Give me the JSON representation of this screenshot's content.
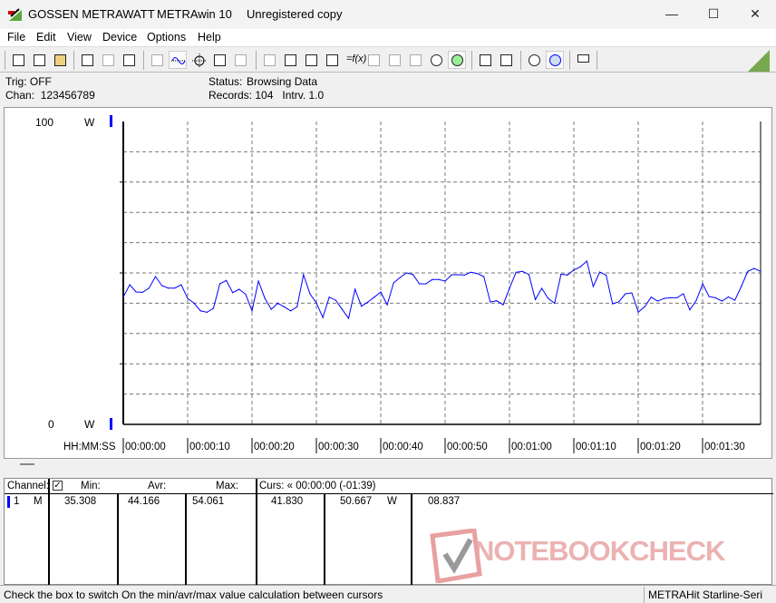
{
  "window": {
    "brand": "GOSSEN METRAWATT",
    "app": "METRAwin 10",
    "license": "Unregistered copy",
    "minimize": "—",
    "maximize": "☐",
    "close": "✕"
  },
  "menu": [
    "File",
    "Edit",
    "View",
    "Device",
    "Options",
    "Help"
  ],
  "toolbar": {
    "icons": [
      "save-icon",
      "save-as-icon",
      "open-icon",
      "read-memory-icon",
      "read-memory-disabled-icon",
      "device-memory-icon",
      "display-values-icon",
      "yt-chart-icon",
      "xy-chart-icon",
      "table-icon",
      "histogram-icon",
      "transfer-icon",
      "import-icon",
      "logic-icon",
      "monitor-icon",
      "function-icon",
      "device-icon",
      "trigger-icon",
      "trigger-wave-icon",
      "clock-icon",
      "stopwatch-icon",
      "print-icon",
      "print-setup-icon",
      "zoom-wave-icon",
      "zoom-icon",
      "comment-icon"
    ],
    "brand_color": "#76a94e"
  },
  "info": {
    "trig": "Trig: OFF",
    "chan": "Chan:  123456789",
    "status_label": "Status:",
    "status_value": "Browsing Data",
    "records": "Records: 104   Intrv. 1.0"
  },
  "chart_data": {
    "type": "line",
    "ylim": [
      0,
      100
    ],
    "y_top_label": "100",
    "y_bottom_label": "0",
    "y_unit": "W",
    "xlabel": "HH:MM:SS",
    "x_ticks": [
      "00:00:00",
      "00:00:10",
      "00:00:20",
      "00:00:30",
      "00:00:40",
      "00:00:50",
      "00:01:00",
      "00:01:10",
      "00:01:20",
      "00:01:30"
    ],
    "interval_s": 1,
    "grid": true,
    "line_color": "#0000ff",
    "values": [
      42.0,
      46.1,
      43.7,
      43.6,
      45.0,
      48.8,
      45.8,
      45.0,
      45.0,
      46.1,
      41.6,
      40.0,
      37.5,
      37.0,
      38.3,
      46.4,
      47.5,
      43.5,
      44.6,
      43.0,
      37.5,
      47.3,
      41.6,
      38.0,
      40.0,
      38.8,
      37.5,
      38.8,
      49.4,
      43.1,
      40.1,
      35.3,
      42.0,
      41.0,
      38.0,
      35.0,
      44.6,
      39.0,
      40.4,
      42.0,
      43.7,
      39.5,
      46.7,
      48.5,
      50.0,
      49.5,
      46.4,
      46.4,
      47.8,
      47.8,
      47.3,
      49.4,
      49.4,
      49.3,
      50.2,
      49.8,
      48.8,
      40.4,
      40.8,
      39.5,
      45.0,
      50.2,
      50.5,
      49.5,
      41.2,
      44.9,
      41.6,
      40.0,
      49.6,
      49.3,
      51.0,
      52.0,
      53.9,
      45.5,
      50.3,
      49.3,
      39.8,
      40.5,
      43.1,
      43.4,
      37.1,
      38.9,
      42.0,
      40.7,
      41.6,
      41.8,
      41.8,
      43.1,
      37.8,
      40.9,
      46.4,
      42.2,
      41.8,
      40.7,
      42.1,
      41.0,
      45.5,
      50.5,
      51.5,
      50.5
    ]
  },
  "table": {
    "headers": {
      "channel": "Channel:",
      "min": "Min:",
      "avr": "Avr:",
      "max": "Max:",
      "curs": "Curs: « 00:00:00 (-01:39)"
    },
    "row": {
      "num": "1",
      "mode": "M",
      "min": "35.308",
      "avr": "44.166",
      "max": "54.061",
      "c1": "41.830",
      "c2": "50.667",
      "unit": "W",
      "diff": "08.837"
    }
  },
  "watermark": "NOTEBOOKCHECK",
  "status": {
    "hint": "Check the box to switch On the min/avr/max value calculation between cursors",
    "device": "METRAHit Starline-Seri"
  }
}
